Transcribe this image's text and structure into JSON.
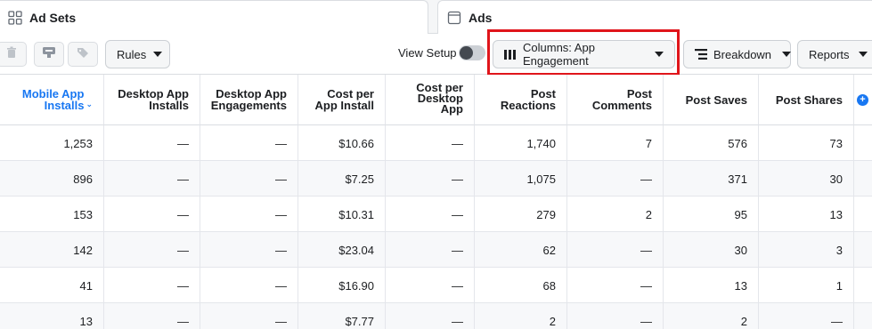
{
  "tabs": {
    "adsets_label": "Ad Sets",
    "ads_label": "Ads"
  },
  "toolbar": {
    "rules_label": "Rules",
    "view_setup_label": "View Setup",
    "columns_label": "Columns: App Engagement",
    "breakdown_label": "Breakdown",
    "reports_label": "Reports",
    "icons": [
      "trash-icon",
      "duplicate-icon",
      "tag-icon",
      "columns-icon",
      "breakdown-icon",
      "adsets-grid-icon",
      "ads-page-icon",
      "add-column-icon"
    ]
  },
  "table": {
    "columns": [
      {
        "line1": "Mobile App",
        "line2": "Installs",
        "sorted": true
      },
      {
        "line1": "Desktop App",
        "line2": "Installs"
      },
      {
        "line1": "Desktop App",
        "line2": "Engagements"
      },
      {
        "line1": "Cost per",
        "line2": "App Install"
      },
      {
        "line1": "Cost per",
        "line2": "Desktop",
        "line3": "App"
      },
      {
        "line1": "Post",
        "line2": "Reactions"
      },
      {
        "line1": "Post",
        "line2": "Comments"
      },
      {
        "line1": "Post Saves"
      },
      {
        "line1": "Post Shares"
      }
    ],
    "rows": [
      [
        "1,253",
        "—",
        "—",
        "$10.66",
        "—",
        "1,740",
        "7",
        "576",
        "73"
      ],
      [
        "896",
        "—",
        "—",
        "$7.25",
        "—",
        "1,075",
        "—",
        "371",
        "30"
      ],
      [
        "153",
        "—",
        "—",
        "$10.31",
        "—",
        "279",
        "2",
        "95",
        "13"
      ],
      [
        "142",
        "—",
        "—",
        "$23.04",
        "—",
        "62",
        "—",
        "30",
        "3"
      ],
      [
        "41",
        "—",
        "—",
        "$16.90",
        "—",
        "68",
        "—",
        "13",
        "1"
      ],
      [
        "13",
        "—",
        "—",
        "$7.77",
        "—",
        "2",
        "—",
        "2",
        "—"
      ]
    ]
  },
  "colors": {
    "accent": "#1877f2",
    "highlight_box": "#e0151b"
  }
}
